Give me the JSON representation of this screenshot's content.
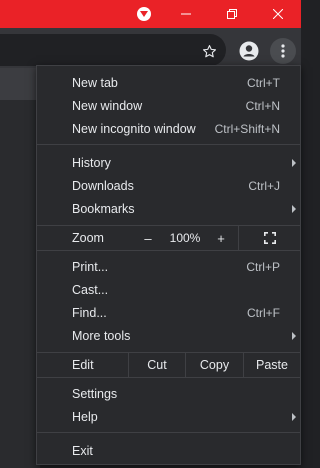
{
  "window": {
    "minimize_icon": "minimize-icon",
    "restore_icon": "restore-icon",
    "close_icon": "close-icon",
    "profile_badge_icon": "chevron-down-icon"
  },
  "toolbar": {
    "bookmark_icon": "star-icon",
    "profile_icon": "avatar-icon",
    "menu_icon": "kebab-menu-icon"
  },
  "menu": {
    "new_tab": {
      "label": "New tab",
      "shortcut": "Ctrl+T"
    },
    "new_window": {
      "label": "New window",
      "shortcut": "Ctrl+N"
    },
    "new_incognito": {
      "label": "New incognito window",
      "shortcut": "Ctrl+Shift+N"
    },
    "history": {
      "label": "History"
    },
    "downloads": {
      "label": "Downloads",
      "shortcut": "Ctrl+J"
    },
    "bookmarks": {
      "label": "Bookmarks"
    },
    "zoom": {
      "label": "Zoom",
      "minus": "–",
      "value": "100%",
      "plus": "+",
      "fullscreen_icon": "fullscreen-icon"
    },
    "print": {
      "label": "Print...",
      "shortcut": "Ctrl+P"
    },
    "cast": {
      "label": "Cast..."
    },
    "find": {
      "label": "Find...",
      "shortcut": "Ctrl+F"
    },
    "more_tools": {
      "label": "More tools"
    },
    "edit": {
      "label": "Edit",
      "cut": "Cut",
      "copy": "Copy",
      "paste": "Paste"
    },
    "settings": {
      "label": "Settings"
    },
    "help": {
      "label": "Help"
    },
    "exit": {
      "label": "Exit"
    }
  },
  "colors": {
    "titlebar": "#ea2227",
    "menu_bg": "#292a2d",
    "text": "#e8eaed"
  }
}
